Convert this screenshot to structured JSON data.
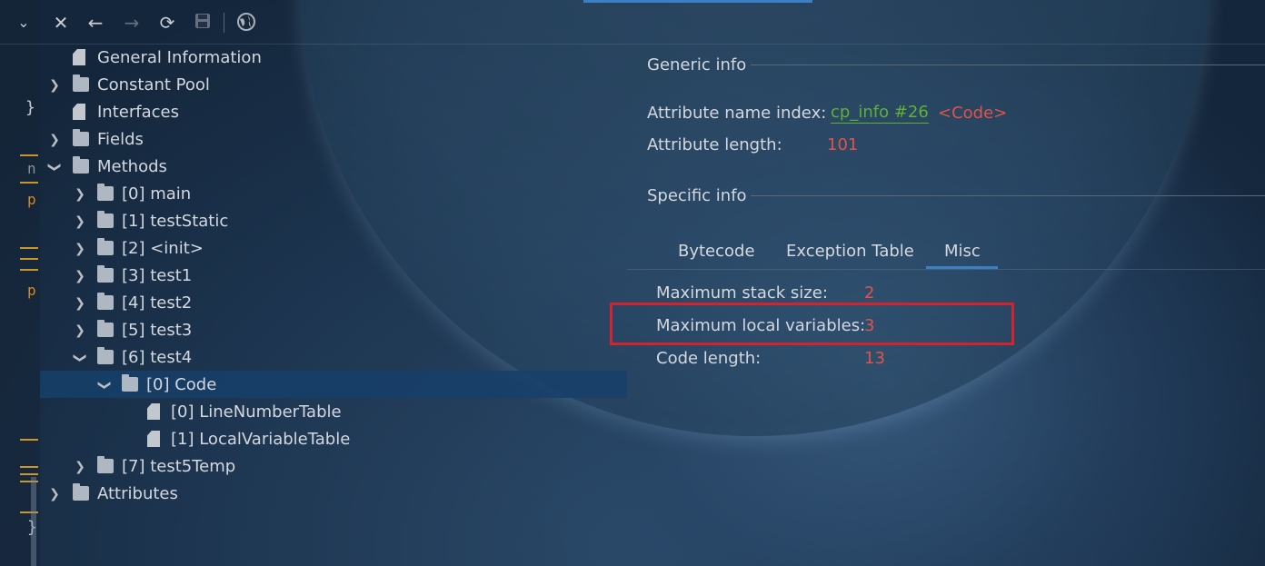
{
  "toolbar": {
    "icons": [
      "chevron-down-icon",
      "close-icon",
      "back-arrow-icon",
      "forward-arrow-icon",
      "refresh-icon",
      "save-icon",
      "globe-icon"
    ]
  },
  "gutter": {
    "marks": [
      "}",
      "n",
      "p",
      "p",
      "}"
    ]
  },
  "tree": {
    "general_information": "General Information",
    "constant_pool": "Constant Pool",
    "interfaces": "Interfaces",
    "fields": "Fields",
    "methods": "Methods",
    "method_0": "[0] main",
    "method_1": "[1] testStatic",
    "method_2": "[2] <init>",
    "method_3": "[3] test1",
    "method_4": "[4] test2",
    "method_5": "[5] test3",
    "method_6": "[6] test4",
    "code": "[0] Code",
    "line_number_table": "[0] LineNumberTable",
    "local_variable_table": "[1] LocalVariableTable",
    "method_7": "[7] test5Temp",
    "attributes": "Attributes"
  },
  "generic_info": {
    "title": "Generic info",
    "attr_name_index_label": "Attribute name index:",
    "attr_name_index_link": "cp_info #26",
    "attr_name_index_value": "<Code>",
    "attr_length_label": "Attribute length:",
    "attr_length_value": "101"
  },
  "specific_info": {
    "title": "Specific info",
    "tabs": [
      "Bytecode",
      "Exception Table",
      "Misc"
    ],
    "active_tab": "Misc",
    "max_stack_label": "Maximum stack size:",
    "max_stack_value": "2",
    "max_locals_label": "Maximum local variables:",
    "max_locals_value": "3",
    "code_length_label": "Code length:",
    "code_length_value": "13"
  },
  "colors": {
    "value_red": "#e0534a",
    "link_green": "#5fb036",
    "accent_blue": "#3d7fc4",
    "highlight_red": "#d1242c",
    "selection": "#16406a"
  }
}
